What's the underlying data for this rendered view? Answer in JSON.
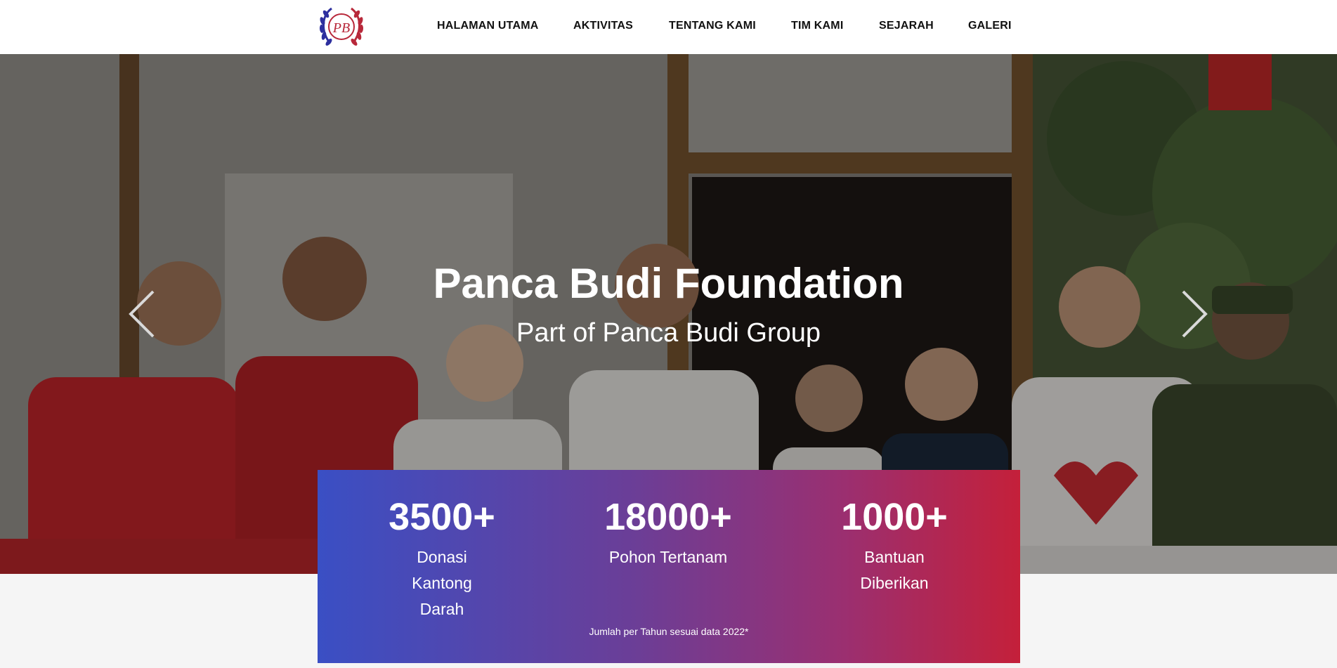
{
  "header": {
    "logo_text": "PB",
    "nav": [
      {
        "label": "HALAMAN UTAMA"
      },
      {
        "label": "AKTIVITAS"
      },
      {
        "label": "TENTANG KAMI"
      },
      {
        "label": "TIM KAMI"
      },
      {
        "label": "SEJARAH"
      },
      {
        "label": "GALERI"
      }
    ]
  },
  "hero": {
    "title": "Panca Budi Foundation",
    "subtitle": "Part of Panca Budi Group",
    "prev_icon": "chevron-left-icon",
    "next_icon": "chevron-right-icon"
  },
  "stats": {
    "items": [
      {
        "value": "3500+",
        "label": "Donasi Kantong Darah"
      },
      {
        "value": "18000+",
        "label": "Pohon Tertanam"
      },
      {
        "value": "1000+",
        "label": "Bantuan Diberikan"
      }
    ],
    "note": "Jumlah per Tahun sesuai data 2022*"
  },
  "colors": {
    "gradient_start": "#3a4fc4",
    "gradient_end": "#c4203a",
    "header_bg": "#ffffff"
  }
}
